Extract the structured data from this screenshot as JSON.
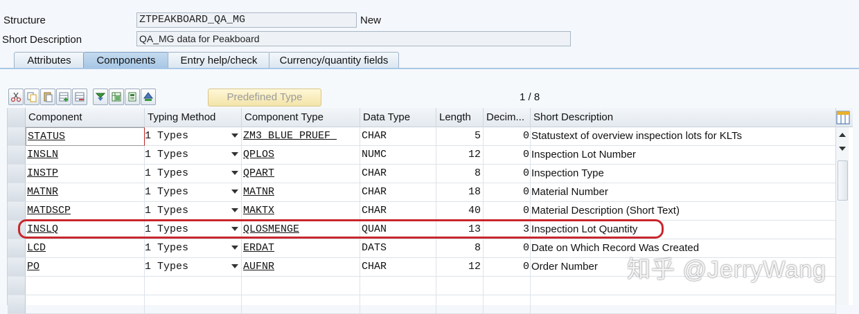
{
  "header": {
    "structure_label": "Structure",
    "structure_value": "ZTPEAKBOARD_QA_MG",
    "status": "New",
    "short_desc_label": "Short Description",
    "short_desc_value": "QA_MG data for Peakboard"
  },
  "tabs": [
    {
      "label": "Attributes",
      "active": false
    },
    {
      "label": "Components",
      "active": true
    },
    {
      "label": "Entry help/check",
      "active": false
    },
    {
      "label": "Currency/quantity fields",
      "active": false
    }
  ],
  "toolbar": {
    "icons": [
      "cut-icon",
      "copy-icon",
      "paste-icon",
      "insert-row-icon",
      "delete-row-icon",
      "filter-down-icon",
      "table-icon",
      "structure-icon",
      "up-icon"
    ],
    "predefined_type_label": "Predefined Type",
    "pager": "1 / 8"
  },
  "table": {
    "columns": [
      "Component",
      "Typing Method",
      "Component Type",
      "Data Type",
      "Length",
      "Decim...",
      "Short Description"
    ],
    "rows": [
      {
        "component": "STATUS",
        "typing": "1 Types",
        "comp_type": "ZM3_BLUE_PRUEF_",
        "data_type": "CHAR",
        "length": "5",
        "decimals": "0",
        "desc": "Statustext of overview inspection lots for KLTs"
      },
      {
        "component": "INSLN",
        "typing": "1 Types",
        "comp_type": "QPLOS",
        "data_type": "NUMC",
        "length": "12",
        "decimals": "0",
        "desc": "Inspection Lot Number"
      },
      {
        "component": "INSTP",
        "typing": "1 Types",
        "comp_type": "QPART",
        "data_type": "CHAR",
        "length": "8",
        "decimals": "0",
        "desc": "Inspection Type"
      },
      {
        "component": "MATNR",
        "typing": "1 Types",
        "comp_type": "MATNR",
        "data_type": "CHAR",
        "length": "18",
        "decimals": "0",
        "desc": "Material Number"
      },
      {
        "component": "MATDSCP",
        "typing": "1 Types",
        "comp_type": "MAKTX",
        "data_type": "CHAR",
        "length": "40",
        "decimals": "0",
        "desc": "Material Description (Short Text)"
      },
      {
        "component": "INSLQ",
        "typing": "1 Types",
        "comp_type": "QLOSMENGE",
        "data_type": "QUAN",
        "length": "13",
        "decimals": "3",
        "desc": "Inspection Lot Quantity"
      },
      {
        "component": "LCD",
        "typing": "1 Types",
        "comp_type": "ERDAT",
        "data_type": "DATS",
        "length": "8",
        "decimals": "0",
        "desc": "Date on Which Record Was Created"
      },
      {
        "component": "PO",
        "typing": "1 Types",
        "comp_type": "AUFNR",
        "data_type": "CHAR",
        "length": "12",
        "decimals": "0",
        "desc": "Order Number"
      }
    ]
  },
  "watermark": "知乎 @JerryWang",
  "colors": {
    "active_tab": "#a8c7e6",
    "highlight": "#c8262e",
    "predefined_bg": "#f3e4a8"
  }
}
